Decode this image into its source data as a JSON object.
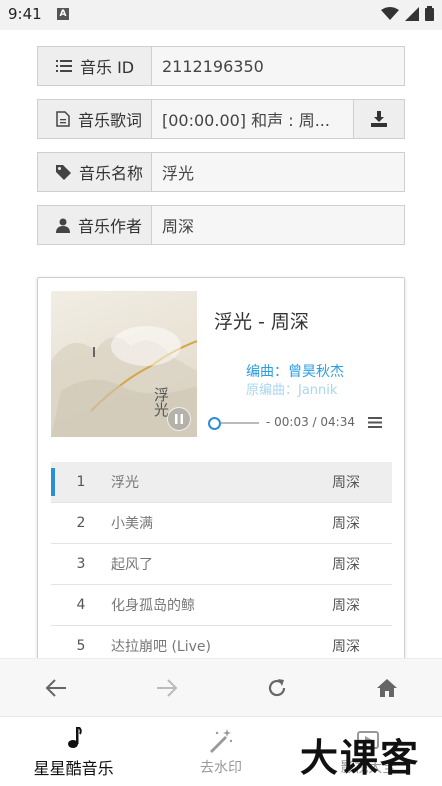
{
  "status_bar": {
    "time": "9:41",
    "notif_icon_label": "A"
  },
  "fields": [
    {
      "label": "音乐 ID",
      "value": "2112196350",
      "icon": "list-icon"
    },
    {
      "label": "音乐歌词",
      "value": "[00:00.00] 和声 : 周...",
      "icon": "document-icon"
    },
    {
      "label": "音乐名称",
      "value": "浮光",
      "icon": "tag-icon"
    },
    {
      "label": "音乐作者",
      "value": "周深",
      "icon": "user-icon"
    }
  ],
  "player": {
    "title": "浮光 - 周深",
    "cover_text": "浮光",
    "lyric_current": "编曲：曾昊秋杰",
    "lyric_next": "原编曲：Jannik",
    "time": "- 00:03 / 04:34",
    "progress_fraction": 0.01
  },
  "playlist": [
    {
      "num": "1",
      "name": "浮光",
      "artist": "周深",
      "active": true
    },
    {
      "num": "2",
      "name": "小美满",
      "artist": "周深"
    },
    {
      "num": "3",
      "name": "起风了",
      "artist": "周深"
    },
    {
      "num": "4",
      "name": "化身孤岛的鲸",
      "artist": "周深"
    },
    {
      "num": "5",
      "name": "达拉崩吧 (Live)",
      "artist": "周深"
    }
  ],
  "browser_nav": [
    "back-icon",
    "forward-icon",
    "refresh-icon",
    "home-icon"
  ],
  "tabs": [
    {
      "label": "星星酷音乐",
      "icon": "music-note-icon"
    },
    {
      "label": "去水印",
      "icon": "magic-wand-icon"
    },
    {
      "label": "影视大全",
      "icon": "film-icon"
    }
  ],
  "watermark": "大课客",
  "colors": {
    "accent": "#2b8fd6",
    "lyric": "#2b9de0"
  }
}
